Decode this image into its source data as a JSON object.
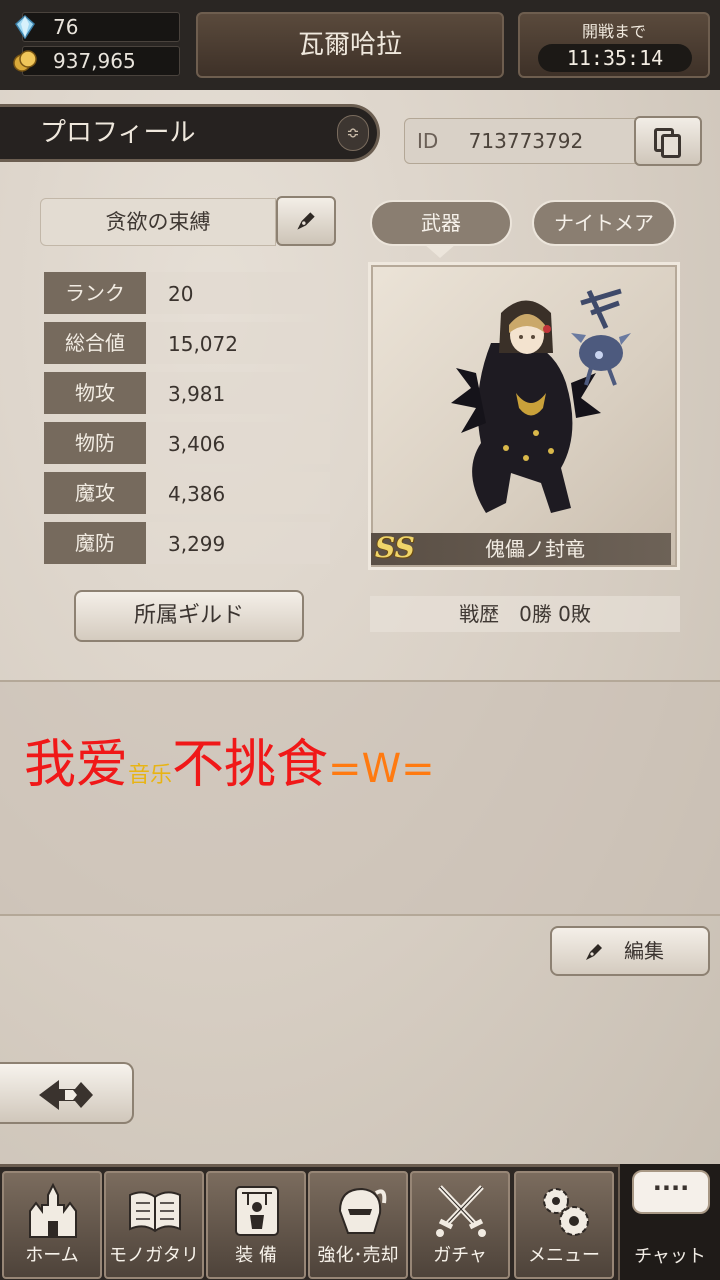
{
  "resources": {
    "gems": "76",
    "gold": "937,965"
  },
  "header": {
    "title": "瓦爾哈拉",
    "battle_label": "開戦まで",
    "battle_time": "11:35:14"
  },
  "profile": {
    "tab_label": "プロフィール",
    "id_label": "ID",
    "id_value": "713773792",
    "name": "贪欲の束縛",
    "stats": [
      {
        "label": "ランク",
        "value": "20"
      },
      {
        "label": "総合値",
        "value": "15,072"
      },
      {
        "label": "物攻",
        "value": "3,981"
      },
      {
        "label": "物防",
        "value": "3,406"
      },
      {
        "label": "魔攻",
        "value": "4,386"
      },
      {
        "label": "魔防",
        "value": "3,299"
      }
    ],
    "guild_button": "所属ギルド"
  },
  "weapon": {
    "tabs": [
      "武器",
      "ナイトメア"
    ],
    "rarity": "SS",
    "name": "傀儡ノ封竜",
    "record": "戦歴　0勝 0敗"
  },
  "comment": {
    "part1": "我爱",
    "part2": "音乐",
    "part3": "不挑食",
    "part4": "=W="
  },
  "edit_button": "編集",
  "nav": [
    {
      "label": "ホーム",
      "icon": "castle-icon"
    },
    {
      "label": "モノガタリ",
      "icon": "book-icon"
    },
    {
      "label": "装 備",
      "icon": "puppet-icon"
    },
    {
      "label": "強化･売却",
      "icon": "helmet-icon"
    },
    {
      "label": "ガチャ",
      "icon": "crossed-swords-icon"
    },
    {
      "label": "メニュー",
      "icon": "gears-icon"
    }
  ],
  "chat": {
    "bubble": "····",
    "label": "チャット"
  },
  "colors": {
    "comment_red": "#f01818",
    "comment_yellow": "#e8b414",
    "comment_orange": "#ff7a10",
    "rarity_gold": "#f0d56a"
  }
}
